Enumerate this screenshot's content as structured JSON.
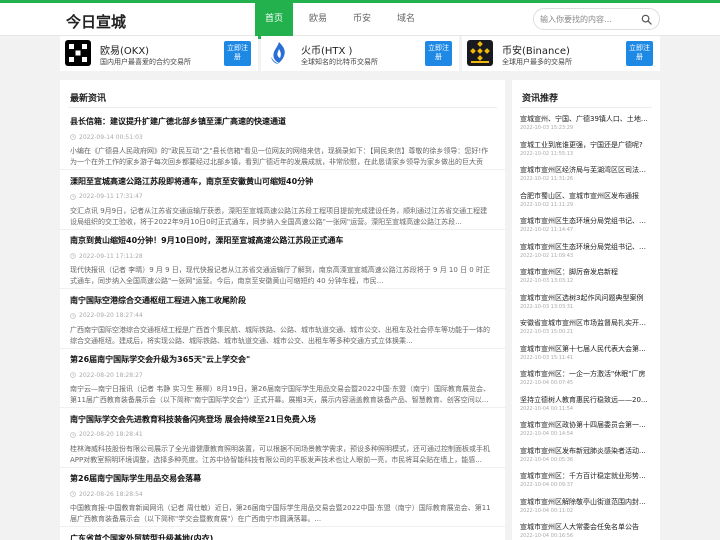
{
  "header": {
    "logo": "今日宣城",
    "nav": [
      "首页",
      "欧易",
      "币安",
      "域名"
    ],
    "search_placeholder": "输入你要找的内容…"
  },
  "exchanges": [
    {
      "name": "欧易(OKX)",
      "desc": "国内用户最喜爱的合约交易所",
      "btn": "立即注册",
      "logo": "okx-logo"
    },
    {
      "name": "火币(HTX )",
      "desc": "全球知名的比特币交易所",
      "btn": "立即注册",
      "logo": "htx-logo"
    },
    {
      "name": "币安(Binance)",
      "desc": "全球用户最多的交易所",
      "btn": "立即注册",
      "logo": "binance-logo"
    }
  ],
  "main": {
    "title": "最新资讯",
    "articles": [
      {
        "title": "县长信箱：建议提升扩建广德北部乡镇至溧广高速的快速通道",
        "time": "2022-09-14 00:51:03",
        "summary": "小编在《广德县人民政府网》的\"政民互动\"之\"县长信箱\"看见一位网友的网络来信，现摘录如下：【网民来信】尊敬的徐乡领导：您好!作为一个在外工作的家乡游子每次回乡都要经过北部乡镇，看到广德近年的发展成就，非常欣慰，在此恳请家乡领导为家乡做出的巨大贡献！作为一个游子常..."
      },
      {
        "title": "溧阳至宣城高速公路江苏段即将通车，南京至安徽黄山可缩短40分钟",
        "time": "2022-09-11 17:31:47",
        "summary": "交汇点讯 9月9日，记者从江苏省交通运输厅获悉，溧阳至宣城高速公路江苏段工程项目提前完成建设任务，顺利通过江苏省交通工程建设局组织的交工验收，将于2022年9月10日0时正式通车，同步纳入全国高速公路\"一张网\"运营。溧阳至宣城高速公路江苏段..."
      },
      {
        "title": "南京到黄山缩短40分钟！9月10日0时，溧阳至宣城高速公路江苏段正式通车",
        "time": "2022-09-11 17:11:28",
        "summary": "现代快报讯（记者 李晴）9 月 9 日，现代快报记者从江苏省交通运输厅了解到，南京高溧宣宣城高速公路江苏段将于 9 月 10 日 0 时正式通车，同步纳入全国高速公路\"一张网\"运营。今后，南京至安徽黄山可缩短约 40 分钟车程，市民..."
      },
      {
        "title": "南宁国际空港综合交通枢纽工程进入施工收尾阶段",
        "time": "2022-09-20 18:27:44",
        "summary": "广西南宁国际空港综合交通枢纽工程是广西首个集民航、城际铁路、公路、城市轨道交通、城市公交、出租车及社会停车等功能于一体的综合交通枢纽。建成后，将实现公路、城际铁路、城市轨道交通、城市公交、出租车等多种交通方式立体换乘..."
      },
      {
        "title": "第26届南宁国际学交会升级为365天\"云上学交会\"",
        "time": "2022-08-20 18:28:27",
        "summary": "南宁云—南宁日报讯（记者 韦静 实习生 蔡柳）8月19日，第26届南宁国际学生用品交易会暨2022中国·东盟（南宁）国际教育展览会、第11届广西教育装备展示会（以下简称\"南宁国际学交会\"）正式开幕。展期3天，展示内容涵盖教育装备产品、智慧教育、创客空间以..."
      },
      {
        "title": "南宁国际学交会先进教育科技装备闪亮登场 展会持续至21日免费入场",
        "time": "2022-08-20 18:28:41",
        "summary": "桂林海威科技股份有限公司展示了全光谱健康教育照明装置，可以根据不同场景教学需求，预设多种照明模式，还可通过控制面板或手机APP对教室照明环境调整，选择多种亮度。江苏中协智能科技有限公司的平板发声技术也让人眼前一亮，市民将耳朵贴在墙上，能感..."
      },
      {
        "title": "第26届南宁国际学生用品交易会落幕",
        "time": "2022-08-26 18:28:54",
        "summary": "中国教育报-中国教育新闻网讯（记者 周仕敏）近日，第26届南宁国际学生用品交易会暨2022中国·东盟（南宁）国际教育展览会、第11届广西教育装备展示会（以下简称\"学交会暨教育展\"）在广西南宁市圆满落幕。..."
      },
      {
        "title": "广东省首个国家外贸转型升级基地(内衣)",
        "time": "",
        "summary": ""
      }
    ]
  },
  "side": {
    "title": "资讯推荐",
    "items": [
      {
        "title": "宣城宣州、宁国、广德39镇人口、土地面积排名",
        "time": "2022-10-03 15:23:29"
      },
      {
        "title": "宣城工业到底谁更强，宁国还是广德呢?",
        "time": "2022-10-02 11:55:13"
      },
      {
        "title": "宣城市宣州区经济局与芜湖湾区区司法局签约",
        "time": "2022-10-02 11:31:26"
      },
      {
        "title": "合肥市蜀山区、宣城市宣州区发布通报",
        "time": "2022-10-02 11:11:29"
      },
      {
        "title": "宣城市宣州区生态环境分局党组书记、局长",
        "time": "2022-10-02 11:14:47"
      },
      {
        "title": "宣城市宣州区生态环境分局党组书记、局长",
        "time": "2022-10-02 11:09:43"
      },
      {
        "title": "宣城市宣州区：脚厉奋发启新程",
        "time": "2022-10-03 13:03:12"
      },
      {
        "title": "宣城市宣州区选树3起作风问题典型案例",
        "time": "2022-10-03 13:03:31"
      },
      {
        "title": "安徽省宣城市宣州区市场监督局扎实开展...",
        "time": "2022-10-03 15:00:21"
      },
      {
        "title": "宣城市宣州区第十七届人民代表大会第...",
        "time": "2022-10-03 15:11:41"
      },
      {
        "title": "宣城市宣州区：一企一方激活\"休眠\"厂房",
        "time": "2022-10-04 00:07:45"
      },
      {
        "title": "坚持立德树人教育惠民行稳致远——20...",
        "time": "2022-10-04 00:11:54"
      },
      {
        "title": "宣城市宣州区政协第十四届委员会第一...",
        "time": "2022-10-04 00:14:54"
      },
      {
        "title": "宣城市宣州区发布新冠肺炎感染者活动...",
        "time": "2022-10-04 00:05:36"
      },
      {
        "title": "宣城市宣州区：千方百计稳定就业形势...",
        "time": "2022-10-04 00:09:37"
      },
      {
        "title": "宣城市宣州区解除敬亭山街道范围内封...",
        "time": "2022-10-04 00:11:02"
      },
      {
        "title": "宣城市宣州区人大常委会任免名单公告",
        "time": "2022-10-04 00:16:56"
      }
    ]
  }
}
